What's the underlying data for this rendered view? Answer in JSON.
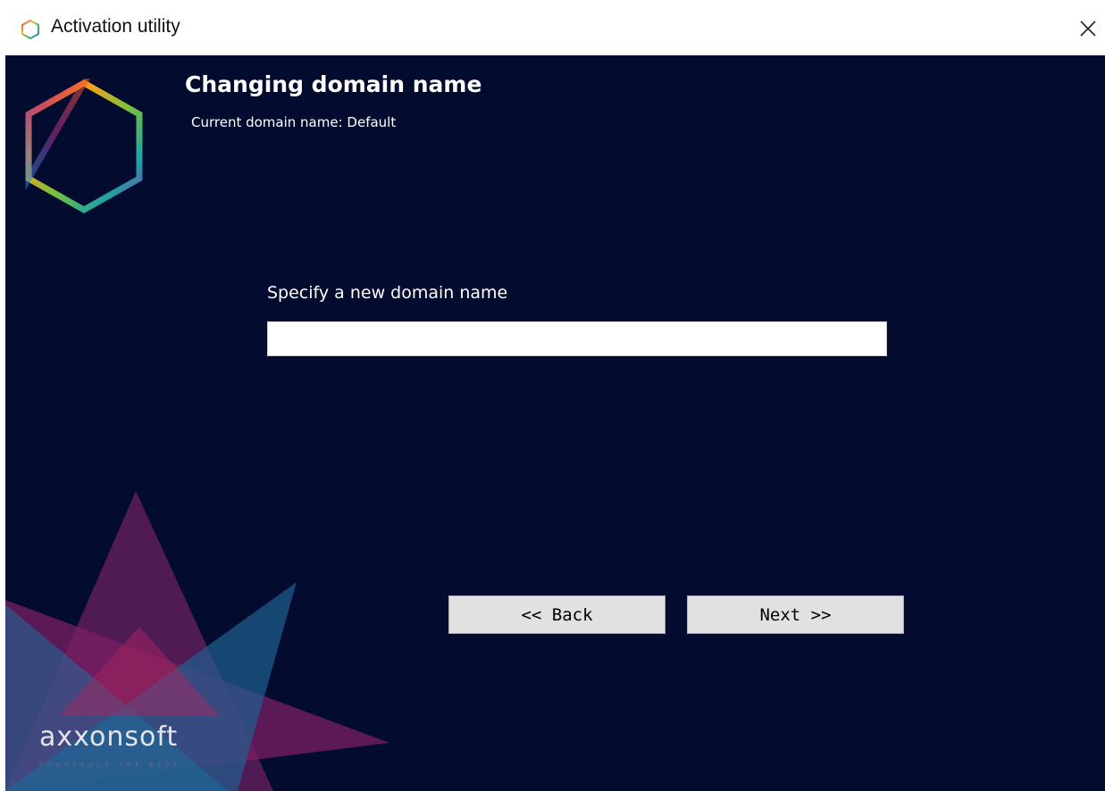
{
  "window": {
    "title": "Activation utility",
    "icon": "hexagon-logo-icon",
    "close_icon": "close-icon"
  },
  "page": {
    "heading": "Changing domain name",
    "current_domain_text": "Current domain name: Default"
  },
  "form": {
    "label": "Specify a new domain name",
    "domain_value": "",
    "placeholder": ""
  },
  "buttons": {
    "back_label": "<< Back",
    "next_label": "Next >>"
  },
  "brand": {
    "name": "axxonsoft",
    "tagline": "CONSTRUCT THE NEXT"
  },
  "colors": {
    "background": "#030b2f",
    "button": "#e1e1e1",
    "text": "#ffffff"
  }
}
